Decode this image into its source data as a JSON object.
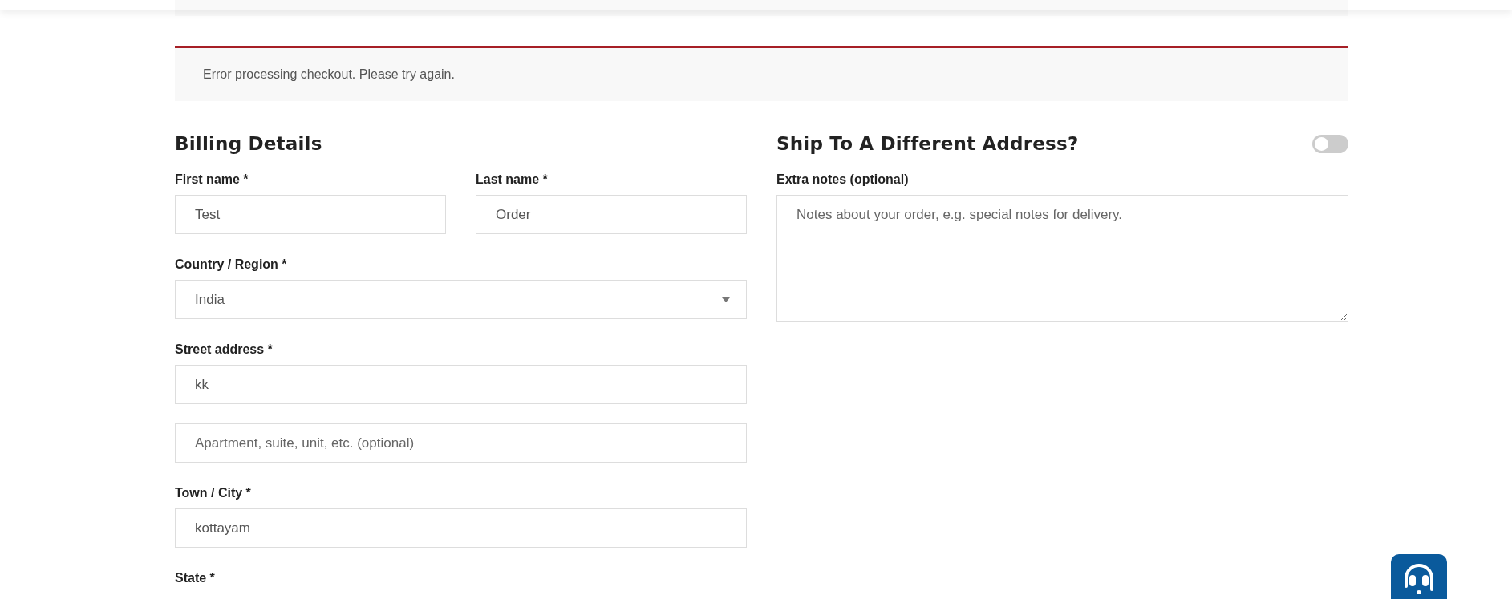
{
  "notice": {
    "message": "Error processing checkout. Please try again."
  },
  "billing": {
    "title": "Billing Details",
    "rows": [
      [
        {
          "kind": "text",
          "label": "First name *",
          "value": "Test"
        },
        {
          "kind": "text",
          "label": "Last name *",
          "value": "Order"
        }
      ],
      [
        {
          "kind": "select",
          "label": "Country / Region *",
          "value": "India"
        }
      ],
      [
        {
          "kind": "text",
          "label": "Street address *",
          "value": "kk"
        }
      ],
      [
        {
          "kind": "text",
          "placeholder": "Apartment, suite, unit, etc. (optional)"
        }
      ],
      [
        {
          "kind": "text",
          "label": "Town / City *",
          "value": "kottayam"
        }
      ],
      [
        {
          "label": "State *"
        }
      ]
    ]
  },
  "shipping": {
    "title": "Ship To A Different Address?",
    "toggle": {
      "on": false
    },
    "notes": {
      "label": "Extra notes (optional)",
      "placeholder": "Notes about your order, e.g. special notes for delivery."
    }
  }
}
